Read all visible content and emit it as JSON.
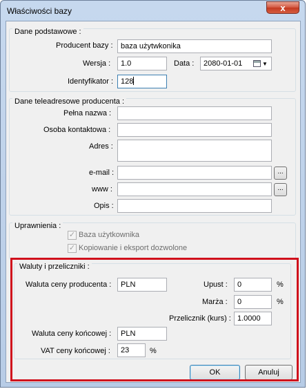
{
  "window": {
    "title": "Właściwości bazy",
    "close_label": "x"
  },
  "dane_podstawowe": {
    "title": "Dane podstawowe :",
    "producent_label": "Producent bazy :",
    "producent_value": "baza użytwkonika",
    "wersja_label": "Wersja :",
    "wersja_value": "1.0",
    "data_label": "Data :",
    "data_value": "2080-01-01",
    "identyfikator_label": "Identyfikator :",
    "identyfikator_value": "128"
  },
  "teleadresowe": {
    "title": "Dane teleadresowe producenta :",
    "pelna_nazwa_label": "Pełna nazwa :",
    "osoba_label": "Osoba kontaktowa :",
    "adres_label": "Adres :",
    "email_label": "e-mail :",
    "www_label": "www :",
    "opis_label": "Opis :",
    "browse_label": "..."
  },
  "uprawnienia": {
    "title": "Uprawnienia :",
    "baza_label": "Baza użytkownika",
    "kopiowanie_label": "Kopiowanie i eksport dozwolone",
    "check_mark": "✓"
  },
  "waluty": {
    "title": "Waluty i przeliczniki :",
    "waluta_prod_label": "Waluta ceny producenta :",
    "waluta_prod_value": "PLN",
    "upust_label": "Upust :",
    "upust_value": "0",
    "marza_label": "Marża :",
    "marza_value": "0",
    "przelicznik_label": "Przelicznik (kurs) :",
    "przelicznik_value": "1.0000",
    "waluta_konc_label": "Waluta ceny końcowej :",
    "waluta_konc_value": "PLN",
    "vat_label": "VAT ceny końcowej :",
    "vat_value": "23",
    "percent": "%"
  },
  "buttons": {
    "ok": "OK",
    "cancel": "Anuluj"
  },
  "colors": {
    "highlight": "#d0101c",
    "close": "#c33a22"
  }
}
